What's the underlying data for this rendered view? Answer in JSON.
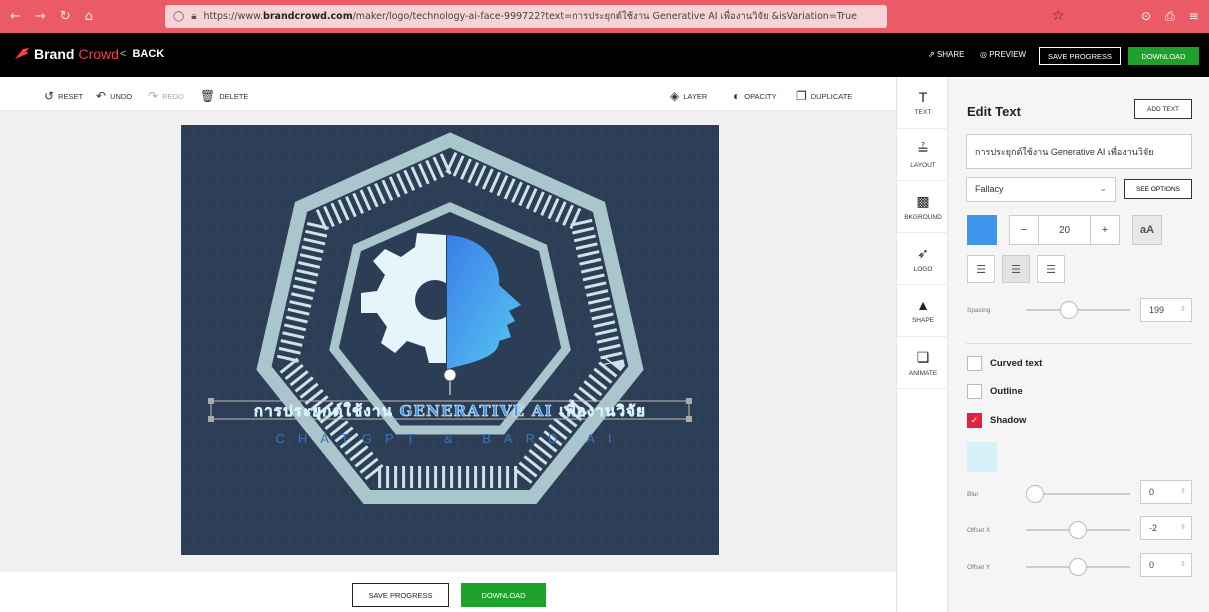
{
  "browser": {
    "url_prefix": "https://www.",
    "url_domain": "brandcrowd.com",
    "url_rest": "/maker/logo/technology-ai-face-999722?text=การประยุกต์ใช้งาน Generative AI เพื่องานวิจัย &isVariation=True"
  },
  "app": {
    "brand_part1": "Brand",
    "brand_part2": "Crowd",
    "back_label": "BACK",
    "share_label": "SHARE",
    "preview_label": "PREVIEW",
    "save_progress_label": "SAVE PROGRESS",
    "download_label": "DOWNLOAD"
  },
  "toolbar": {
    "reset": "RESET",
    "undo": "UNDO",
    "redo": "REDO",
    "delete": "DELETE",
    "layer": "LAYER",
    "opacity": "OPACITY",
    "duplicate": "DUPLICATE"
  },
  "canvas": {
    "main_text": "การประยุกต์ใช้งาน GENERATIVE AI เพื่องานวิจัย",
    "sub_text": "CHATGPT & BARD AI",
    "background_color": "#2c3e55"
  },
  "tabs": [
    {
      "label": "TEXT",
      "icon": "text-icon"
    },
    {
      "label": "LAYOUT",
      "icon": "layout-icon"
    },
    {
      "label": "BKGROUND",
      "icon": "background-icon"
    },
    {
      "label": "LOGO",
      "icon": "logo-icon"
    },
    {
      "label": "SHAPE",
      "icon": "shape-icon"
    },
    {
      "label": "ANIMATE",
      "icon": "animate-icon"
    }
  ],
  "panel": {
    "title": "Edit Text",
    "add_text": "ADD TEXT",
    "text_value": "การประยุกต์ใช้งาน Generative AI เพื่องานวิจัย",
    "font": "Fallacy",
    "see_options": "SEE OPTIONS",
    "text_color": "#3d96ea",
    "font_size": "20",
    "case_toggle": "aA",
    "spacing_label": "Spacing",
    "spacing_value": "199",
    "curved_text": "Curved text",
    "outline": "Outline",
    "shadow": "Shadow",
    "shadow_color": "#d7f1fb",
    "blur_label": "Blur",
    "blur_value": "0",
    "offset_x_label": "Offset X",
    "offset_x_value": "-2",
    "offset_y_label": "Offset Y",
    "offset_y_value": "0"
  }
}
